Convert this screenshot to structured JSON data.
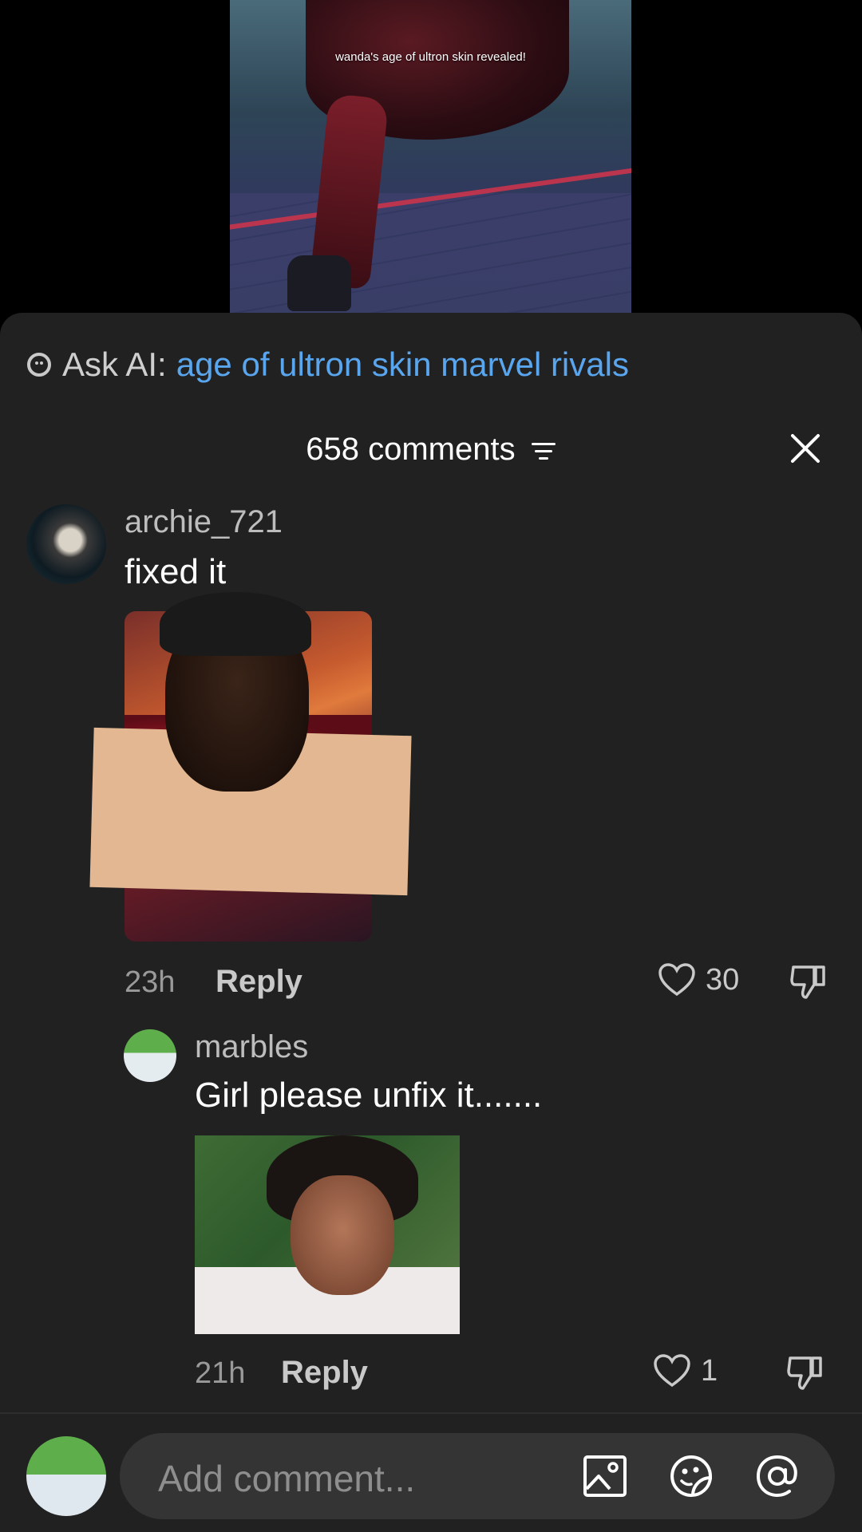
{
  "video": {
    "caption": "wanda's age of ultron skin revealed!"
  },
  "ask_ai": {
    "label": "Ask AI:",
    "query": "age of ultron skin marvel rivals"
  },
  "header": {
    "title": "658 comments"
  },
  "comments": [
    {
      "username": "archie_721",
      "text": "fixed it",
      "time": "23h",
      "reply_label": "Reply",
      "likes": "30"
    },
    {
      "username": "marbles",
      "text": "Girl please unfix it.......",
      "time": "21h",
      "reply_label": "Reply",
      "likes": "1"
    }
  ],
  "composer": {
    "placeholder": "Add comment..."
  },
  "colors": {
    "sheet_bg": "#212121",
    "link_blue": "#5aa6ee",
    "input_bg": "#343434"
  }
}
